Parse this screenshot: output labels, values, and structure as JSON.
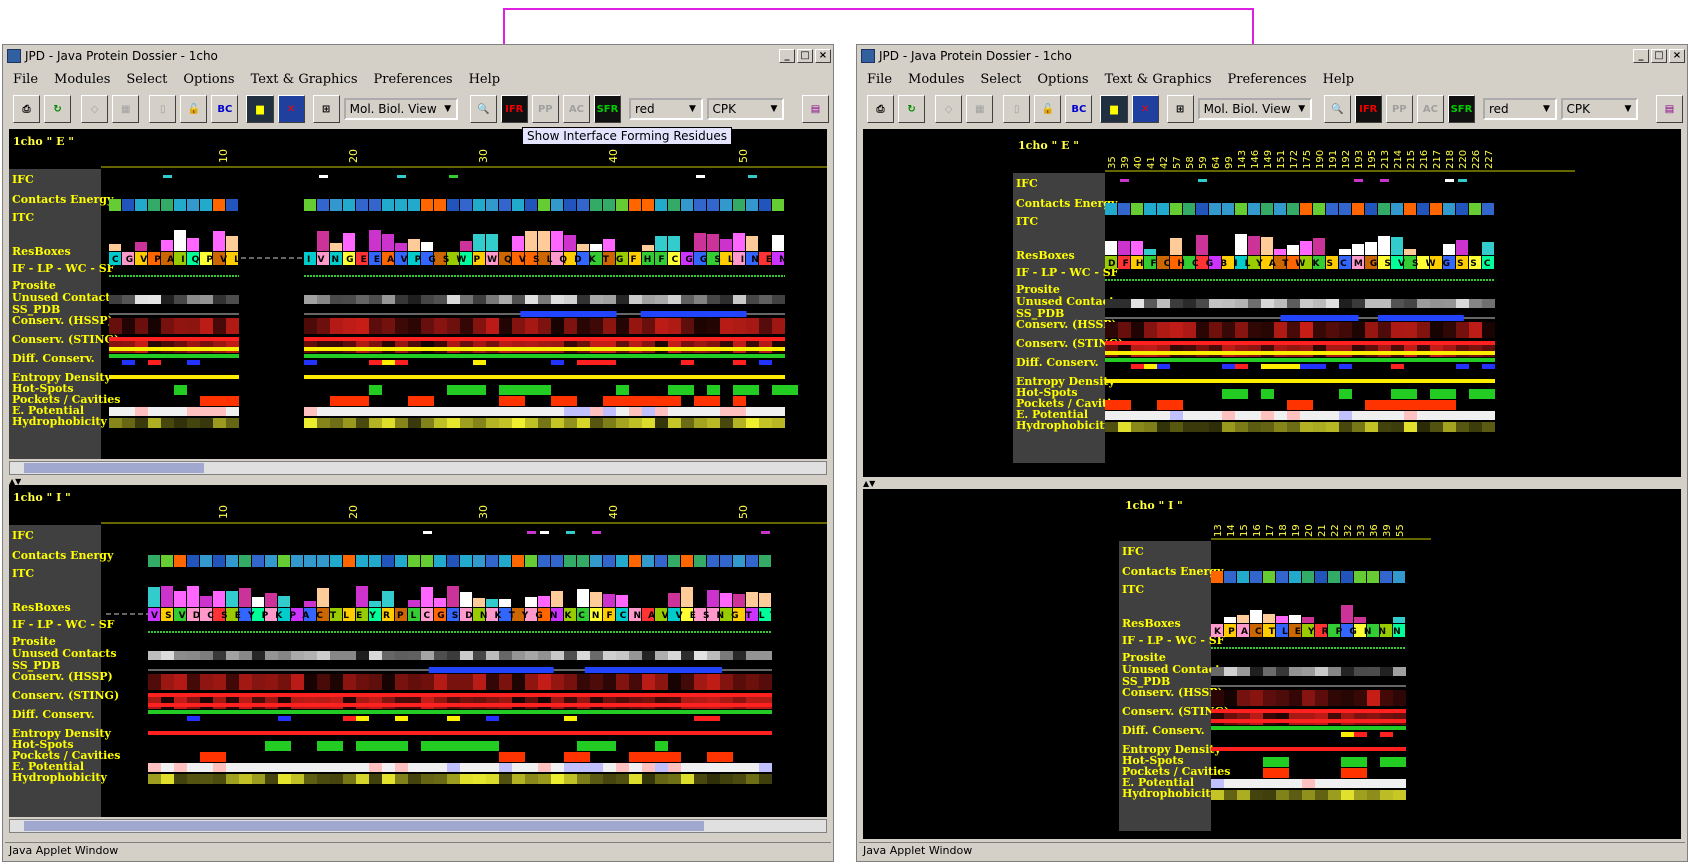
{
  "annotation": {
    "color": "#e020e0"
  },
  "app": {
    "title": "JPD - Java Protein Dossier - 1cho",
    "status": "Java Applet Window"
  },
  "menu": [
    "File",
    "Modules",
    "Select",
    "Options",
    "Text & Graphics",
    "Preferences",
    "Help"
  ],
  "toolbar": {
    "view_combo": "Mol. Biol. View",
    "color_combo": "red",
    "scheme_combo": "CPK",
    "btn_bc": "BC",
    "btn_ifr": "IFR",
    "btn_sfr": "SFR",
    "btn_pp": "PP",
    "btn_ac": "AC"
  },
  "tooltip": "Show Interface Forming Residues",
  "row_labels": [
    "IFC",
    "Contacts Energy",
    "ITC",
    "ResBoxes",
    "IF - LP - WC - SF",
    "Prosite",
    "Unused Contacts",
    "SS_PDB",
    "Conserv. (HSSP)",
    "Conserv. (STING)",
    "Diff. Conserv.",
    "Entropy Density",
    "Hot-Spots",
    "Pockets / Cavities",
    "E. Potential",
    "Hydrophobicity"
  ],
  "left": {
    "chain_e_title": "1cho \" E \"",
    "chain_i_title": "1cho \" I \"",
    "ruler": [
      "10",
      "20",
      "30",
      "40",
      "50"
    ],
    "seq_e1": "CGVPAIQPVL",
    "seq_e2": "IVNGEEAVPGSWPWQVSLQDKTGFHFCGGSLINENWV",
    "seq_i": "VSVDCSEYPKPACTLEYRPLCGSDNKTYGNKCNFCNAVVESNGTLTLS"
  },
  "right": {
    "chain_e_title": "1cho \" E \"",
    "chain_i_title": "1cho \" I \"",
    "ruler_e": [
      "35",
      "39",
      "40",
      "41",
      "42",
      "57",
      "58",
      "59",
      "64",
      "99",
      "143",
      "146",
      "149",
      "151",
      "172",
      "175",
      "190",
      "191",
      "192",
      "193",
      "195",
      "213",
      "214",
      "215",
      "216",
      "217",
      "218",
      "220",
      "226",
      "227"
    ],
    "seq_e": "DFHFCHCGBILYATWKSCMGSVSWGSSCGV",
    "ruler_i": [
      "13",
      "14",
      "15",
      "16",
      "17",
      "18",
      "19",
      "20",
      "21",
      "22",
      "32",
      "33",
      "36",
      "39",
      "55"
    ],
    "seq_i": "KPACTLEYRPGNNNK"
  }
}
